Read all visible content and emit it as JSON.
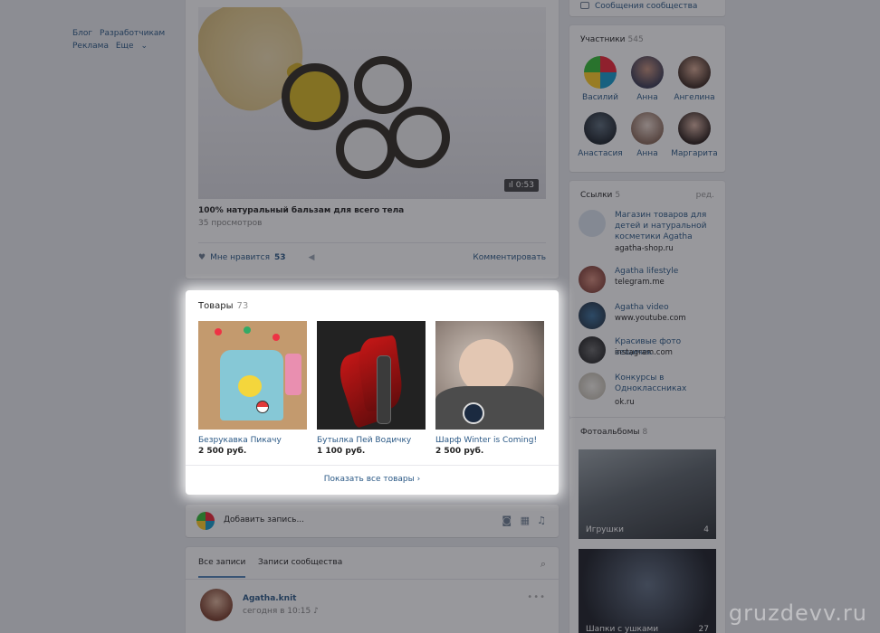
{
  "footer_links": [
    "Блог",
    "Разработчикам",
    "Реклама",
    "Еще"
  ],
  "video_post": {
    "duration": "0:53",
    "title": "100% натуральный бальзам для всего тела",
    "views": "35 просмотров",
    "like_label": "Мне нравится",
    "like_count": "53",
    "comment_label": "Комментировать"
  },
  "goods": {
    "title": "Товары",
    "count": "73",
    "items": [
      {
        "name": "Безрукавка Пикачу",
        "price": "2 500 руб."
      },
      {
        "name": "Бутылка Пей Водичку",
        "price": "1 100 руб."
      },
      {
        "name": "Шарф Winter is Coming!",
        "price": "2 500 руб."
      }
    ],
    "show_all": "Показать все товары"
  },
  "add_post": {
    "placeholder": "Добавить запись..."
  },
  "wall": {
    "tabs": [
      "Все записи",
      "Записи сообщества"
    ],
    "author": "Agatha.knit",
    "date": "сегодня в 10:15"
  },
  "right": {
    "messages_label": "Сообщения сообщества",
    "members": {
      "title": "Участники",
      "count": "545",
      "people": [
        "Василий",
        "Анна",
        "Ангелина",
        "Анастасия",
        "Анна",
        "Маргарита"
      ]
    },
    "links": {
      "title": "Ссылки",
      "count": "5",
      "edit": "ред.",
      "items": [
        {
          "title": "Магазин товаров для детей и натуральной косметики Agatha",
          "url": "agatha-shop.ru"
        },
        {
          "title": "Agatha lifestyle",
          "url": "telegram.me"
        },
        {
          "title": "Agatha video",
          "url": "www.youtube.com"
        },
        {
          "title": "Красивые фото вещичек",
          "url": "instagram.com"
        },
        {
          "title": "Конкурсы в Одноклассниках",
          "url": "ok.ru"
        }
      ]
    },
    "albums": {
      "title": "Фотоальбомы",
      "count": "8",
      "items": [
        {
          "label": "Игрушки",
          "count": "4"
        },
        {
          "label": "Шапки с ушками",
          "count": "27"
        }
      ]
    }
  },
  "watermark": "gruzdevv.ru"
}
